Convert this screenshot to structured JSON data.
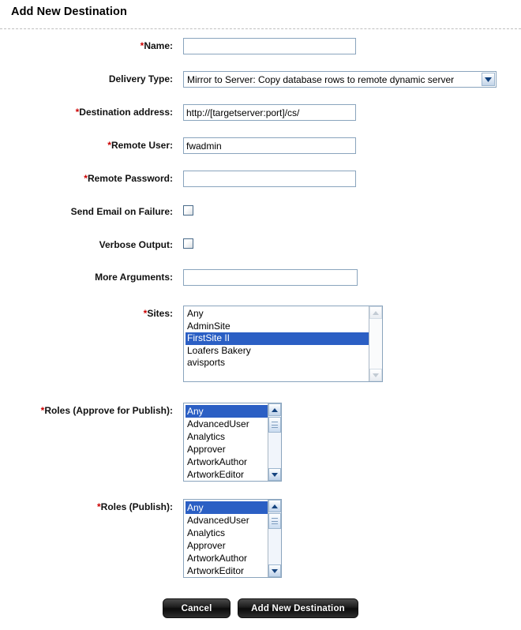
{
  "page": {
    "title": "Add New Destination"
  },
  "form": {
    "name": {
      "label": "Name:",
      "required": "*",
      "value": "",
      "placeholder": ""
    },
    "delivery_type": {
      "label": "Delivery Type:",
      "required": "",
      "selected": "Mirror to Server: Copy database rows to remote dynamic server",
      "arrow_icon": "chevron-down-icon"
    },
    "destination_address": {
      "label": "Destination address:",
      "required": "*",
      "value": "http://[targetserver:port]/cs/",
      "placeholder": ""
    },
    "remote_user": {
      "label": "Remote User:",
      "required": "*",
      "value": "fwadmin",
      "placeholder": ""
    },
    "remote_password": {
      "label": "Remote Password:",
      "required": "*",
      "value": "",
      "placeholder": ""
    },
    "send_email_on_failure": {
      "label": "Send Email on Failure:",
      "required": "",
      "checked": false
    },
    "verbose_output": {
      "label": "Verbose Output:",
      "required": "",
      "checked": false
    },
    "more_arguments": {
      "label": "More Arguments:",
      "required": "",
      "value": "",
      "placeholder": ""
    },
    "sites": {
      "label": "Sites:",
      "required": "*",
      "options": [
        {
          "label": "Any",
          "selected": false
        },
        {
          "label": "AdminSite",
          "selected": false
        },
        {
          "label": "FirstSite II",
          "selected": true
        },
        {
          "label": "Loafers Bakery",
          "selected": false
        },
        {
          "label": "avisports",
          "selected": false
        }
      ],
      "scrollbar": {
        "enabled": false,
        "up_icon": "scroll-up-arrow-icon",
        "down_icon": "scroll-down-arrow-icon"
      }
    },
    "roles_approve_for_publish": {
      "label": "Roles (Approve for Publish):",
      "required": "*",
      "options": [
        {
          "label": "Any",
          "selected": true
        },
        {
          "label": "AdvancedUser",
          "selected": false
        },
        {
          "label": "Analytics",
          "selected": false
        },
        {
          "label": "Approver",
          "selected": false
        },
        {
          "label": "ArtworkAuthor",
          "selected": false
        },
        {
          "label": "ArtworkEditor",
          "selected": false
        }
      ],
      "scrollbar": {
        "enabled": true,
        "up_icon": "scroll-up-arrow-icon",
        "down_icon": "scroll-down-arrow-icon"
      }
    },
    "roles_publish": {
      "label": "Roles (Publish):",
      "required": "*",
      "options": [
        {
          "label": "Any",
          "selected": true
        },
        {
          "label": "AdvancedUser",
          "selected": false
        },
        {
          "label": "Analytics",
          "selected": false
        },
        {
          "label": "Approver",
          "selected": false
        },
        {
          "label": "ArtworkAuthor",
          "selected": false
        },
        {
          "label": "ArtworkEditor",
          "selected": false
        }
      ],
      "scrollbar": {
        "enabled": true,
        "up_icon": "scroll-up-arrow-icon",
        "down_icon": "scroll-down-arrow-icon"
      }
    }
  },
  "buttons": {
    "cancel": "Cancel",
    "submit": "Add New Destination"
  },
  "colors": {
    "required_marker": "#cc0000",
    "selection": "#2b5fc4",
    "input_border": "#8aa4bd",
    "rule": "#bfbfbf"
  }
}
